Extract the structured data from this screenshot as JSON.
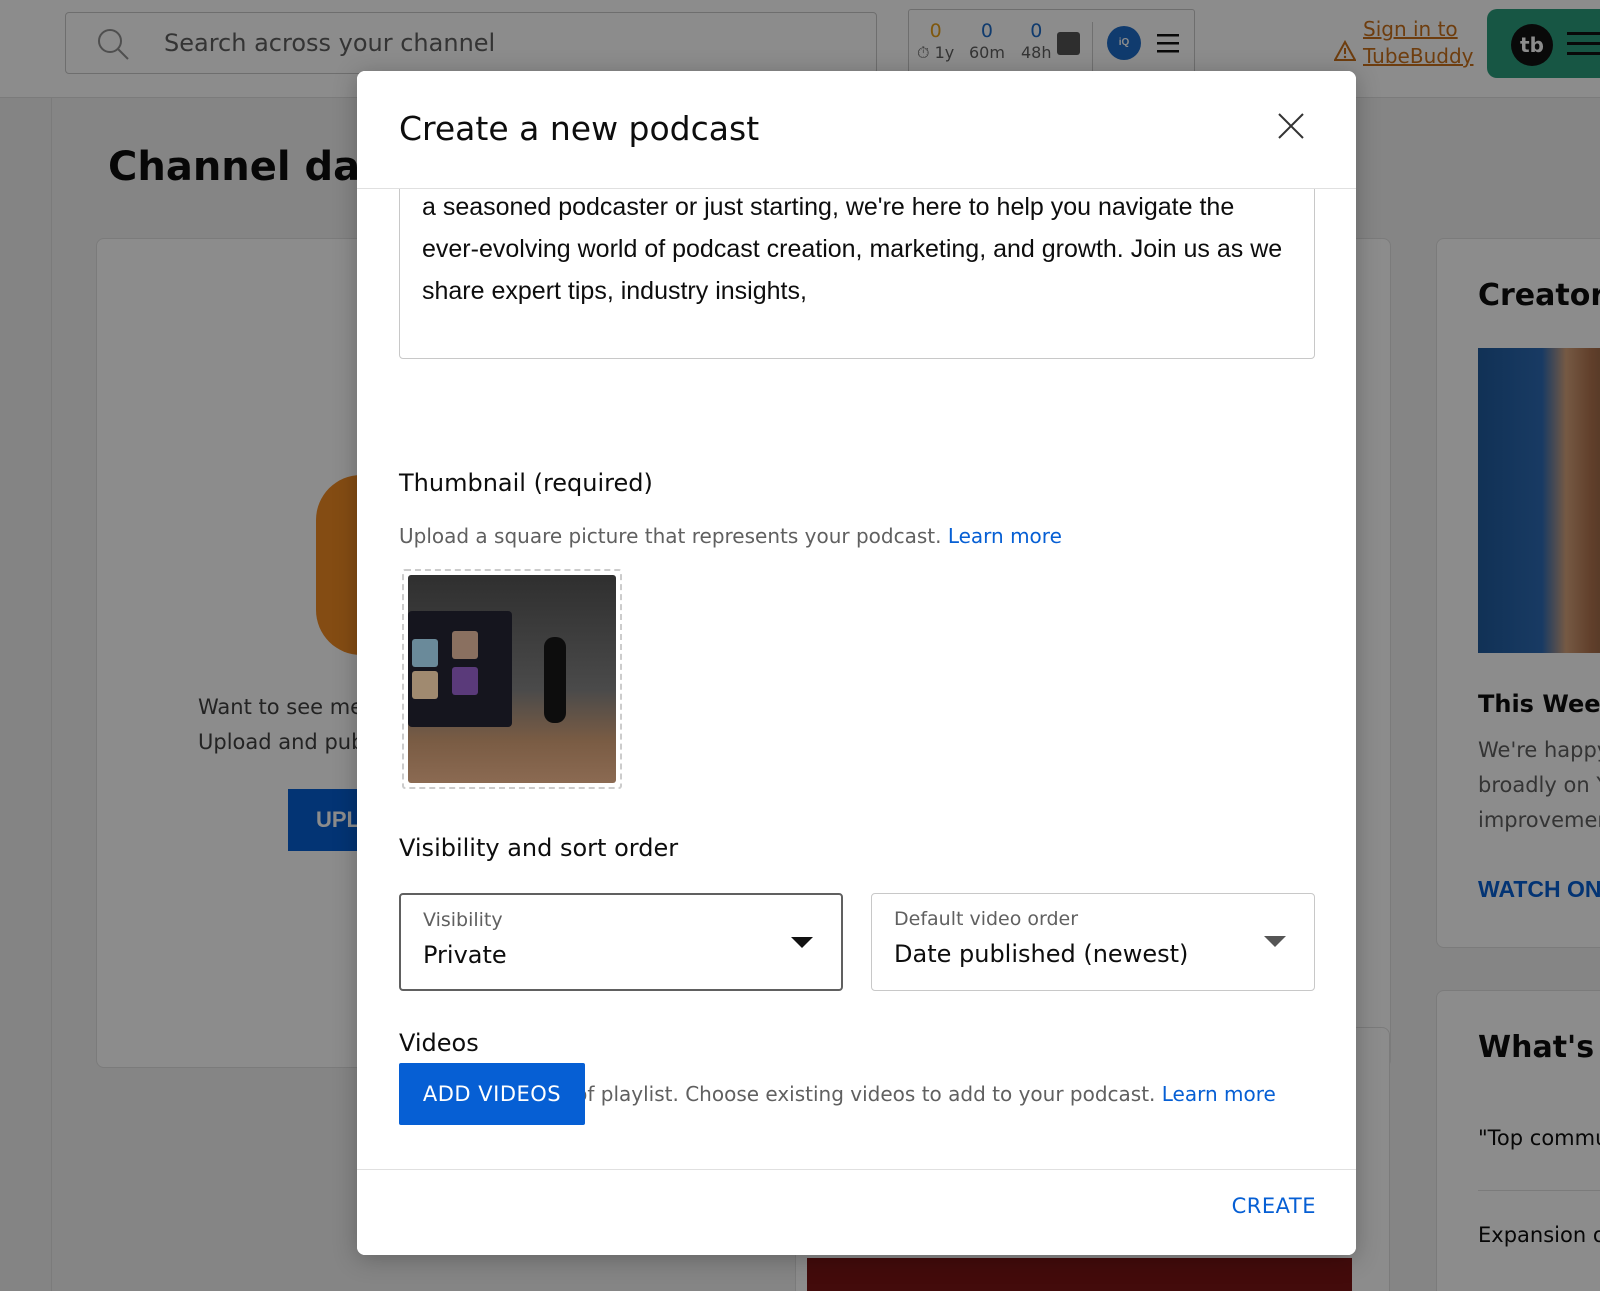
{
  "background": {
    "search": {
      "placeholder": "Search across your channel"
    },
    "tubebuddy_stats": {
      "items": [
        {
          "value": "0",
          "label": "1y",
          "color": "#e8a01a"
        },
        {
          "value": "0",
          "label": "60m",
          "color": "#1e6cc8"
        },
        {
          "value": "0",
          "label": "48h",
          "color": "#1e6cc8"
        }
      ],
      "iq_label": "iQ"
    },
    "tubebuddy_signin": {
      "line1": "Sign in to",
      "line2": "TubeBuddy"
    },
    "tubebuddy_logo": "tb",
    "page_title": "Channel dash",
    "upload_card": {
      "line1": "Want to see me",
      "line2": "Upload and pub",
      "button": "UPL"
    },
    "creator_card": {
      "title": "Creator I",
      "week_title": "This Week",
      "week_lines": [
        "We're happy",
        "broadly on Y",
        "improvemen"
      ],
      "watch_link": "WATCH ON"
    },
    "news_card": {
      "title": "What's ne",
      "items": [
        "\"Top commu",
        "Expansion o"
      ]
    }
  },
  "dialog": {
    "title": "Create a new podcast",
    "description": "Welcome to the ultimate destination for everything podcasting! Whether you're a seasoned podcaster or just starting, we're here to help you navigate the ever-evolving world of podcast creation, marketing, and growth. Join us as we share expert tips, industry insights,",
    "thumbnail": {
      "title": "Thumbnail (required)",
      "helper": "Upload a square picture that represents your podcast.",
      "learn_more": "Learn more"
    },
    "visibility_section": {
      "title": "Visibility and sort order",
      "visibility": {
        "label": "Visibility",
        "value": "Private"
      },
      "sort_order": {
        "label": "Default video order",
        "value": "Date published (newest)"
      }
    },
    "videos_section": {
      "title": "Videos",
      "helper": "Podcast is a type of playlist. Choose existing videos to add to your podcast.",
      "learn_more": "Learn more",
      "add_button": "ADD VIDEOS"
    },
    "create_button": "CREATE"
  },
  "colors": {
    "accent": "#065fd4",
    "tubebuddy_green": "#2a9d7c",
    "tubebuddy_orange": "#c8701a"
  }
}
